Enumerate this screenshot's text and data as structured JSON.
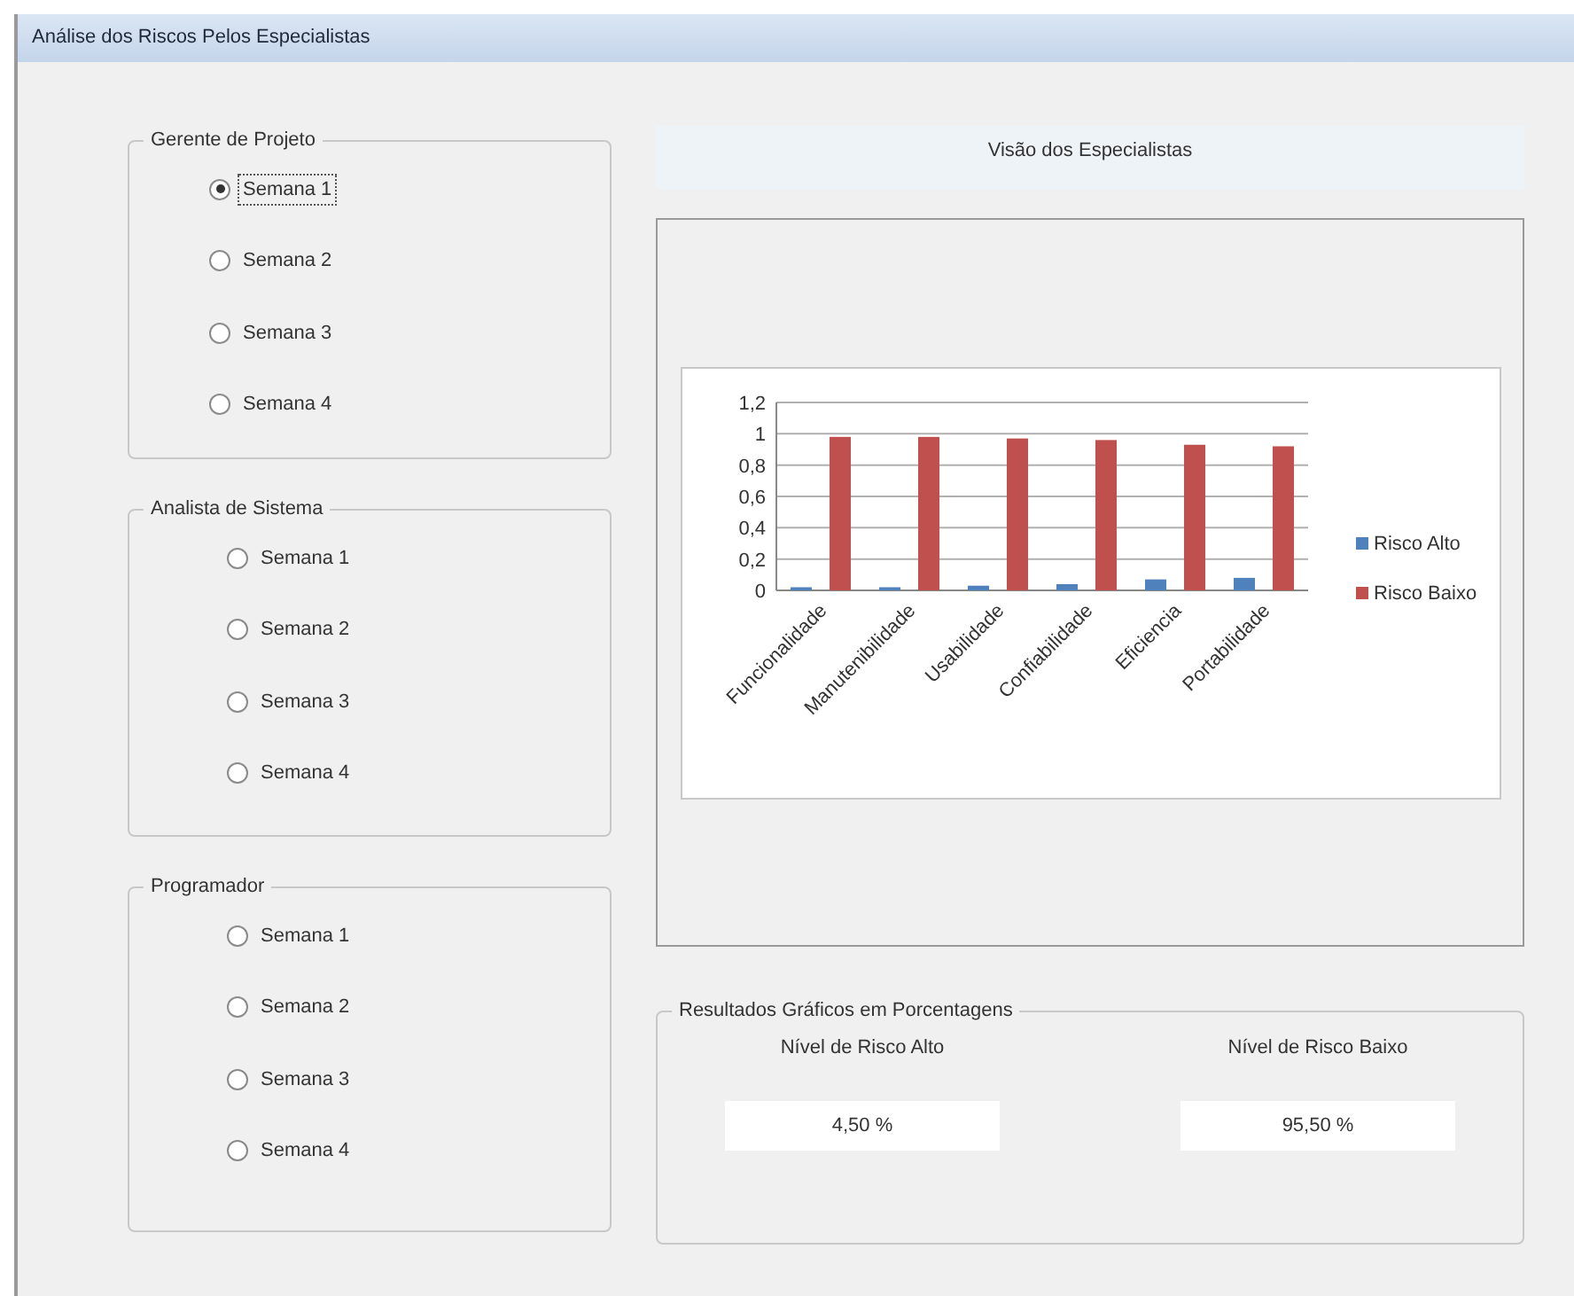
{
  "window": {
    "title": "Análise dos Riscos Pelos Especialistas"
  },
  "groups": [
    {
      "title": "Gerente de Projeto",
      "options": [
        {
          "label": "Semana 1",
          "selected": true
        },
        {
          "label": "Semana 2",
          "selected": false
        },
        {
          "label": "Semana 3",
          "selected": false
        },
        {
          "label": "Semana 4",
          "selected": false
        }
      ]
    },
    {
      "title": "Analista de Sistema",
      "options": [
        {
          "label": "Semana 1",
          "selected": false
        },
        {
          "label": "Semana 2",
          "selected": false
        },
        {
          "label": "Semana 3",
          "selected": false
        },
        {
          "label": "Semana 4",
          "selected": false
        }
      ]
    },
    {
      "title": "Programador",
      "options": [
        {
          "label": "Semana 1",
          "selected": false
        },
        {
          "label": "Semana 2",
          "selected": false
        },
        {
          "label": "Semana 3",
          "selected": false
        },
        {
          "label": "Semana 4",
          "selected": false
        }
      ]
    }
  ],
  "chart_header": "Visão dos Especialistas",
  "chart_data": {
    "type": "bar",
    "categories": [
      "Funcionalidade",
      "Manutenibilidade",
      "Usabilidade",
      "Confiabilidade",
      "Eficiencia",
      "Portabilidade"
    ],
    "series": [
      {
        "name": "Risco Alto",
        "color": "#4f81bd",
        "values": [
          0.02,
          0.02,
          0.03,
          0.04,
          0.07,
          0.08
        ]
      },
      {
        "name": "Risco Baixo",
        "color": "#c0504d",
        "values": [
          0.98,
          0.98,
          0.97,
          0.96,
          0.93,
          0.92
        ]
      }
    ],
    "ylim": [
      0,
      1.2
    ],
    "grid": true,
    "legend": true,
    "yticks": [
      {
        "value": 0,
        "label": "0"
      },
      {
        "value": 0.2,
        "label": "0,2"
      },
      {
        "value": 0.4,
        "label": "0,4"
      },
      {
        "value": 0.6,
        "label": "0,6"
      },
      {
        "value": 0.8,
        "label": "0,8"
      },
      {
        "value": 1,
        "label": "1"
      },
      {
        "value": 1.2,
        "label": "1,2"
      }
    ]
  },
  "results": {
    "title": "Resultados Gráficos em Porcentagens",
    "items": [
      {
        "label": "Nível de Risco Alto",
        "value": "4,50 %"
      },
      {
        "label": "Nível de Risco Baixo",
        "value": "95,50 %"
      }
    ]
  }
}
